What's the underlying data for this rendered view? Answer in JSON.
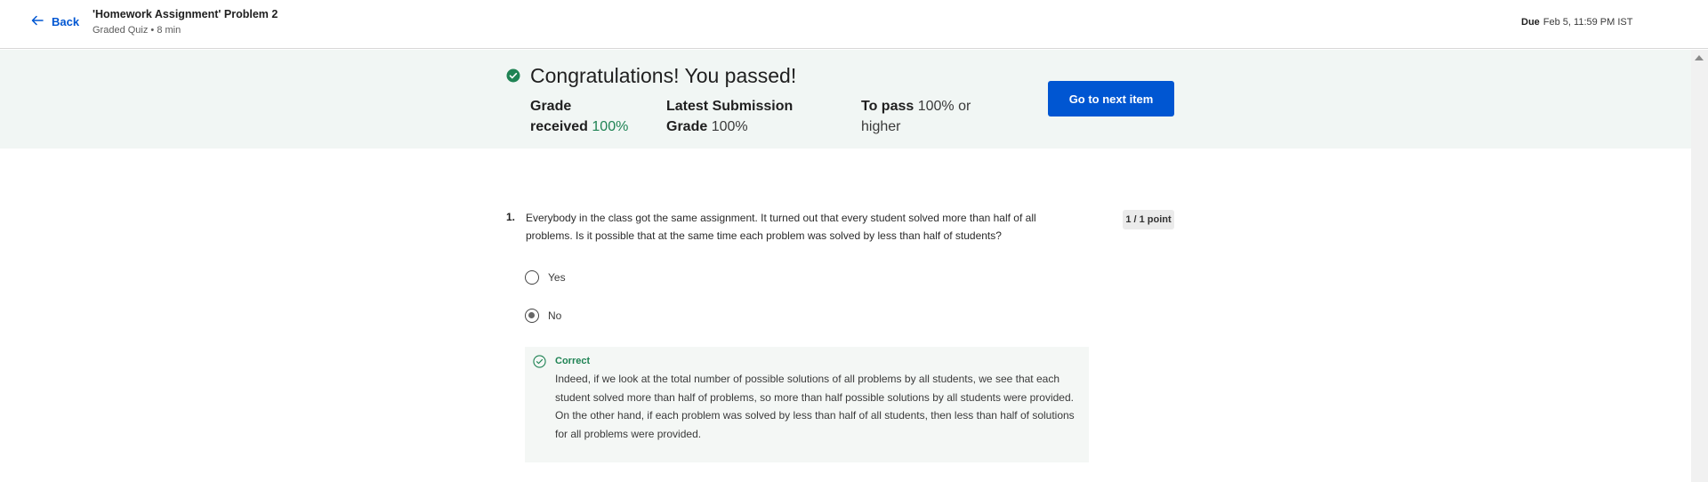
{
  "header": {
    "back_label": "Back",
    "title": "'Homework Assignment' Problem 2",
    "subtitle": "Graded Quiz • 8 min",
    "due_label": "Due",
    "due_value": "Feb 5, 11:59 PM IST"
  },
  "banner": {
    "title": "Congratulations! You passed!",
    "grade_received_label_1": "Grade",
    "grade_received_label_2": "received",
    "grade_received_value": "100%",
    "latest_label_1": "Latest Submission",
    "latest_label_2": "Grade",
    "latest_value": "100%",
    "pass_label": "To pass",
    "pass_value_1": "100% or",
    "pass_value_2": "higher",
    "next_button": "Go to next item"
  },
  "question": {
    "number": "1.",
    "text": "Everybody in the class got the same assignment. It turned out that every student solved more than half of all problems. Is it possible that at the same time each problem was solved by less than half of students?",
    "points": "1 / 1 point",
    "options": [
      {
        "label": "Yes",
        "selected": false
      },
      {
        "label": "No",
        "selected": true
      }
    ],
    "feedback_label": "Correct",
    "feedback_text": "Indeed, if we look at the total number of possible solutions of all problems by all students, we see that each student solved more than half of problems, so more than half possible solutions by all students were provided. On the other hand, if each problem was solved by less than half of all students, then less than half of solutions for all problems were provided."
  },
  "colors": {
    "accent": "#0056d2",
    "success": "#1f8354",
    "banner_bg": "#f1f6f4"
  }
}
